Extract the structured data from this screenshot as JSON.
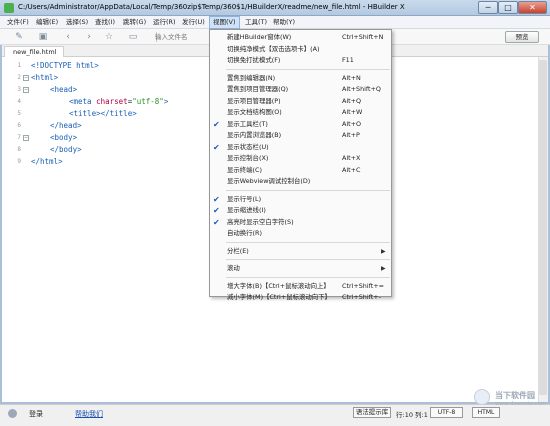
{
  "window": {
    "title": "C:/Users/Administrator/AppData/Local/Temp/360zip$Temp/360$1/HBuilderX/readme/new_file.html - HBuilder X",
    "min": "─",
    "max": "□",
    "close": "✕"
  },
  "menubar": [
    "文件(F)",
    "编辑(E)",
    "选择(S)",
    "查找(I)",
    "跳转(G)",
    "运行(R)",
    "发行(U)",
    "视图(V)",
    "工具(T)",
    "帮助(Y)"
  ],
  "toolbar": {
    "icons": [
      "new-file-icon",
      "save-icon",
      "back-arrow-icon",
      "forward-arrow-icon",
      "star-icon",
      "folder-icon"
    ],
    "file_input_placeholder": "输入文件名",
    "preview_label": "预览"
  },
  "tabs": [
    {
      "label": "new_file.html"
    }
  ],
  "editor": {
    "lines": [
      {
        "n": "1",
        "fold": "",
        "indent": 0,
        "text": "<!DOCTYPE html>"
      },
      {
        "n": "2",
        "fold": "−",
        "indent": 0,
        "text": "<html>"
      },
      {
        "n": "3",
        "fold": "−",
        "indent": 1,
        "text": "<head>"
      },
      {
        "n": "4",
        "fold": "",
        "indent": 2,
        "text": "<meta charset=\"utf-8\">"
      },
      {
        "n": "5",
        "fold": "",
        "indent": 2,
        "text": "<title></title>"
      },
      {
        "n": "6",
        "fold": "",
        "indent": 1,
        "text": "</head>"
      },
      {
        "n": "7",
        "fold": "−",
        "indent": 1,
        "text": "<body>"
      },
      {
        "n": "8",
        "fold": "",
        "indent": 1,
        "text": "</body>"
      },
      {
        "n": "9",
        "fold": "",
        "indent": 0,
        "text": "</html>"
      }
    ]
  },
  "view_menu": {
    "groups": [
      [
        {
          "label": "新建HBuilder窗体(W)",
          "shortcut": "Ctrl+Shift+N",
          "checked": false
        },
        {
          "label": "切换纯净模式【双击选项卡】(A)",
          "shortcut": "",
          "checked": false
        },
        {
          "label": "切换免打扰模式(F)",
          "shortcut": "F11",
          "checked": false
        }
      ],
      [
        {
          "label": "置焦到编辑器(N)",
          "shortcut": "Alt+N",
          "checked": false
        },
        {
          "label": "置焦到项目管理器(Q)",
          "shortcut": "Alt+Shift+Q",
          "checked": false
        },
        {
          "label": "显示项目管理器(P)",
          "shortcut": "Alt+Q",
          "checked": false
        },
        {
          "label": "显示文档结构图(O)",
          "shortcut": "Alt+W",
          "checked": false
        },
        {
          "label": "显示工具栏(T)",
          "shortcut": "Alt+O",
          "checked": true
        },
        {
          "label": "显示内置浏览器(B)",
          "shortcut": "Alt+P",
          "checked": false
        },
        {
          "label": "显示状态栏(U)",
          "shortcut": "",
          "checked": true
        },
        {
          "label": "显示控制台(X)",
          "shortcut": "Alt+X",
          "checked": false
        },
        {
          "label": "显示终端(C)",
          "shortcut": "Alt+C",
          "checked": false
        },
        {
          "label": "显示Webview调试控制台(D)",
          "shortcut": "",
          "checked": false
        }
      ],
      [
        {
          "label": "显示行号(L)",
          "shortcut": "",
          "checked": true
        },
        {
          "label": "显示缩进线(I)",
          "shortcut": "",
          "checked": true
        },
        {
          "label": "高亮时显示空白字符(S)",
          "shortcut": "",
          "checked": true
        },
        {
          "label": "自动换行(R)",
          "shortcut": "",
          "checked": false
        }
      ],
      [
        {
          "label": "分栏(E)",
          "shortcut": "",
          "checked": false,
          "submenu": true
        }
      ],
      [
        {
          "label": "滚动",
          "shortcut": "",
          "checked": false,
          "submenu": true
        }
      ],
      [
        {
          "label": "增大字体(B)【Ctrl+鼠标滚动向上】",
          "shortcut": "Ctrl+Shift+=",
          "checked": false
        },
        {
          "label": "减小字体(M)【Ctrl+鼠标滚动向下】",
          "shortcut": "Ctrl+Shift+-",
          "checked": false
        }
      ]
    ],
    "check_glyph": "✔",
    "arrow_glyph": "▶"
  },
  "statusbar": {
    "login": "登录",
    "help": "帮助我们",
    "syntax": "语法提示库",
    "position": "行:10 列:1",
    "encoding": "UTF-8",
    "language": "HTML"
  },
  "watermark": {
    "title": "当下软件园",
    "url": "www.downxia.com"
  },
  "colors": {
    "tag": "#1a5fb4",
    "attr": "#b00040",
    "string": "#2a8f2a",
    "check": "#1c5ab8",
    "title_bar": "#b3c9e1"
  }
}
